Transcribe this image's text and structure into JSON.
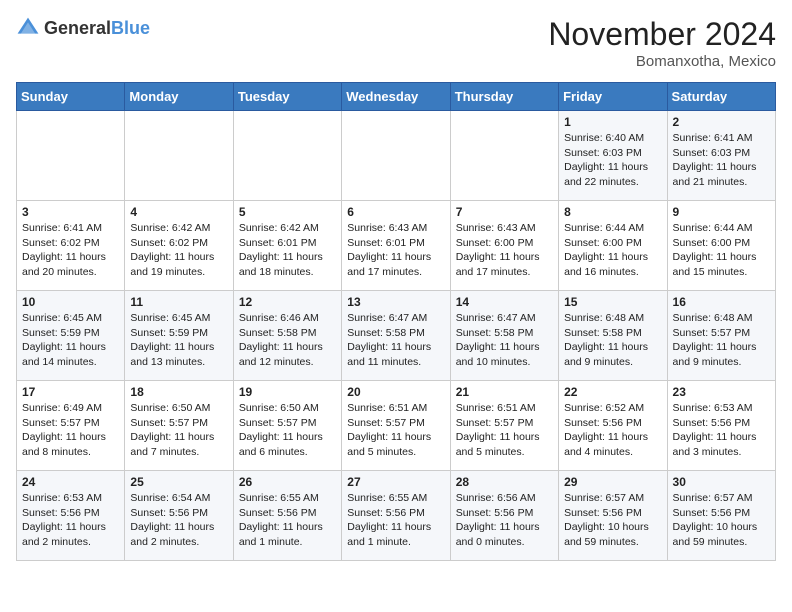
{
  "header": {
    "logo_general": "General",
    "logo_blue": "Blue",
    "month_title": "November 2024",
    "location": "Bomanxotha, Mexico"
  },
  "weekdays": [
    "Sunday",
    "Monday",
    "Tuesday",
    "Wednesday",
    "Thursday",
    "Friday",
    "Saturday"
  ],
  "weeks": [
    [
      {
        "day": "",
        "info": ""
      },
      {
        "day": "",
        "info": ""
      },
      {
        "day": "",
        "info": ""
      },
      {
        "day": "",
        "info": ""
      },
      {
        "day": "",
        "info": ""
      },
      {
        "day": "1",
        "info": "Sunrise: 6:40 AM\nSunset: 6:03 PM\nDaylight: 11 hours\nand 22 minutes."
      },
      {
        "day": "2",
        "info": "Sunrise: 6:41 AM\nSunset: 6:03 PM\nDaylight: 11 hours\nand 21 minutes."
      }
    ],
    [
      {
        "day": "3",
        "info": "Sunrise: 6:41 AM\nSunset: 6:02 PM\nDaylight: 11 hours\nand 20 minutes."
      },
      {
        "day": "4",
        "info": "Sunrise: 6:42 AM\nSunset: 6:02 PM\nDaylight: 11 hours\nand 19 minutes."
      },
      {
        "day": "5",
        "info": "Sunrise: 6:42 AM\nSunset: 6:01 PM\nDaylight: 11 hours\nand 18 minutes."
      },
      {
        "day": "6",
        "info": "Sunrise: 6:43 AM\nSunset: 6:01 PM\nDaylight: 11 hours\nand 17 minutes."
      },
      {
        "day": "7",
        "info": "Sunrise: 6:43 AM\nSunset: 6:00 PM\nDaylight: 11 hours\nand 17 minutes."
      },
      {
        "day": "8",
        "info": "Sunrise: 6:44 AM\nSunset: 6:00 PM\nDaylight: 11 hours\nand 16 minutes."
      },
      {
        "day": "9",
        "info": "Sunrise: 6:44 AM\nSunset: 6:00 PM\nDaylight: 11 hours\nand 15 minutes."
      }
    ],
    [
      {
        "day": "10",
        "info": "Sunrise: 6:45 AM\nSunset: 5:59 PM\nDaylight: 11 hours\nand 14 minutes."
      },
      {
        "day": "11",
        "info": "Sunrise: 6:45 AM\nSunset: 5:59 PM\nDaylight: 11 hours\nand 13 minutes."
      },
      {
        "day": "12",
        "info": "Sunrise: 6:46 AM\nSunset: 5:58 PM\nDaylight: 11 hours\nand 12 minutes."
      },
      {
        "day": "13",
        "info": "Sunrise: 6:47 AM\nSunset: 5:58 PM\nDaylight: 11 hours\nand 11 minutes."
      },
      {
        "day": "14",
        "info": "Sunrise: 6:47 AM\nSunset: 5:58 PM\nDaylight: 11 hours\nand 10 minutes."
      },
      {
        "day": "15",
        "info": "Sunrise: 6:48 AM\nSunset: 5:58 PM\nDaylight: 11 hours\nand 9 minutes."
      },
      {
        "day": "16",
        "info": "Sunrise: 6:48 AM\nSunset: 5:57 PM\nDaylight: 11 hours\nand 9 minutes."
      }
    ],
    [
      {
        "day": "17",
        "info": "Sunrise: 6:49 AM\nSunset: 5:57 PM\nDaylight: 11 hours\nand 8 minutes."
      },
      {
        "day": "18",
        "info": "Sunrise: 6:50 AM\nSunset: 5:57 PM\nDaylight: 11 hours\nand 7 minutes."
      },
      {
        "day": "19",
        "info": "Sunrise: 6:50 AM\nSunset: 5:57 PM\nDaylight: 11 hours\nand 6 minutes."
      },
      {
        "day": "20",
        "info": "Sunrise: 6:51 AM\nSunset: 5:57 PM\nDaylight: 11 hours\nand 5 minutes."
      },
      {
        "day": "21",
        "info": "Sunrise: 6:51 AM\nSunset: 5:57 PM\nDaylight: 11 hours\nand 5 minutes."
      },
      {
        "day": "22",
        "info": "Sunrise: 6:52 AM\nSunset: 5:56 PM\nDaylight: 11 hours\nand 4 minutes."
      },
      {
        "day": "23",
        "info": "Sunrise: 6:53 AM\nSunset: 5:56 PM\nDaylight: 11 hours\nand 3 minutes."
      }
    ],
    [
      {
        "day": "24",
        "info": "Sunrise: 6:53 AM\nSunset: 5:56 PM\nDaylight: 11 hours\nand 2 minutes."
      },
      {
        "day": "25",
        "info": "Sunrise: 6:54 AM\nSunset: 5:56 PM\nDaylight: 11 hours\nand 2 minutes."
      },
      {
        "day": "26",
        "info": "Sunrise: 6:55 AM\nSunset: 5:56 PM\nDaylight: 11 hours\nand 1 minute."
      },
      {
        "day": "27",
        "info": "Sunrise: 6:55 AM\nSunset: 5:56 PM\nDaylight: 11 hours\nand 1 minute."
      },
      {
        "day": "28",
        "info": "Sunrise: 6:56 AM\nSunset: 5:56 PM\nDaylight: 11 hours\nand 0 minutes."
      },
      {
        "day": "29",
        "info": "Sunrise: 6:57 AM\nSunset: 5:56 PM\nDaylight: 10 hours\nand 59 minutes."
      },
      {
        "day": "30",
        "info": "Sunrise: 6:57 AM\nSunset: 5:56 PM\nDaylight: 10 hours\nand 59 minutes."
      }
    ]
  ]
}
